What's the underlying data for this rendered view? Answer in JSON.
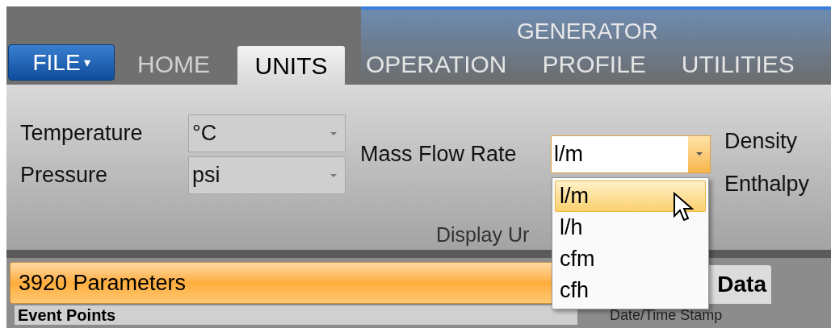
{
  "file_button": {
    "label": "FILE",
    "caret": "▾"
  },
  "tabs": [
    {
      "label": "HOME",
      "selected": false,
      "in_group": false
    },
    {
      "label": "UNITS",
      "selected": true,
      "in_group": false
    },
    {
      "label": "OPERATION",
      "selected": false,
      "in_group": true
    },
    {
      "label": "PROFILE",
      "selected": false,
      "in_group": true
    },
    {
      "label": "UTILITIES",
      "selected": false,
      "in_group": true
    }
  ],
  "tab_group_label": "GENERATOR",
  "units": {
    "left": [
      {
        "label": "Temperature",
        "value": "°C"
      },
      {
        "label": "Pressure",
        "value": "psi"
      }
    ],
    "mass_flow": {
      "label": "Mass Flow Rate",
      "value": "l/m",
      "open": true,
      "options": [
        {
          "label": "l/m",
          "selected": true
        },
        {
          "label": "l/h",
          "selected": false
        },
        {
          "label": "cfm",
          "selected": false
        },
        {
          "label": "cfh",
          "selected": false
        }
      ]
    },
    "right": [
      "Density",
      "Enthalpy"
    ],
    "group_label": "Display Ur"
  },
  "parameters_bar": "3920 Parameters",
  "data_tab": "Data",
  "event_points": "Event Points",
  "date_time_column": "Date/Time Stamp"
}
